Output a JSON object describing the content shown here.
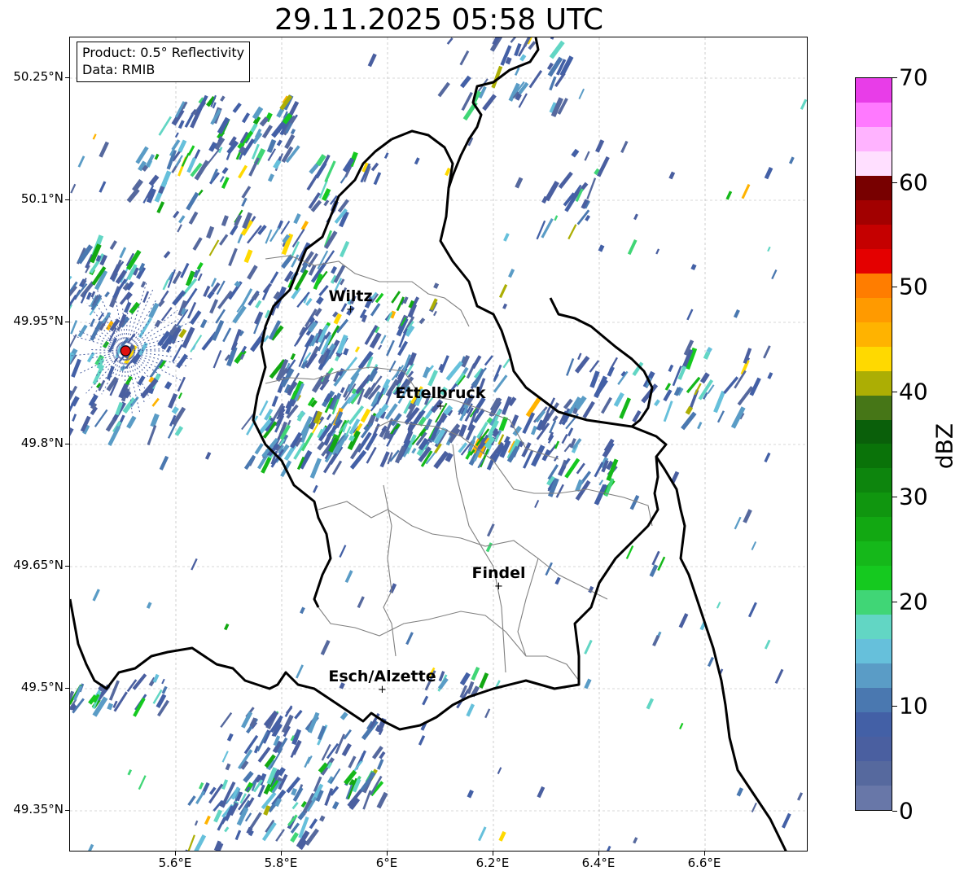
{
  "title": "29.11.2025 05:58 UTC",
  "info": {
    "product": "Product: 0.5° Reflectivity",
    "data_source": "Data: RMIB"
  },
  "lat_ticks": [
    "50.25°N",
    "50.1°N",
    "49.95°N",
    "49.8°N",
    "49.65°N",
    "49.5°N",
    "49.35°N"
  ],
  "lon_ticks": [
    "5.6°E",
    "5.8°E",
    "6°E",
    "6.2°E",
    "6.4°E",
    "6.6°E"
  ],
  "cities": [
    {
      "name": "Wiltz",
      "lon": 5.93,
      "lat": 49.967
    },
    {
      "name": "Ettelbruck",
      "lon": 6.1,
      "lat": 49.848
    },
    {
      "name": "Findel",
      "lon": 6.21,
      "lat": 49.627
    },
    {
      "name": "Esch/Alzette",
      "lon": 5.99,
      "lat": 49.5
    }
  ],
  "radar_site": {
    "lon": 5.505,
    "lat": 49.915,
    "color": "#e01010"
  },
  "colorbar": {
    "label": "dBZ",
    "ticks": [
      "0",
      "10",
      "20",
      "30",
      "40",
      "50",
      "60",
      "70"
    ],
    "min": 0,
    "max": 70,
    "step": 2.5,
    "colors": [
      "#6877a8",
      "#56699e",
      "#4a5fa0",
      "#4360a6",
      "#4a78b0",
      "#5a9cc6",
      "#66c0db",
      "#62d6c4",
      "#40d676",
      "#15c91f",
      "#15b81a",
      "#12a812",
      "#10960f",
      "#0d850d",
      "#0a7309",
      "#0a5f0a",
      "#467617",
      "#acae04",
      "#ffd900",
      "#ffb300",
      "#ff9a00",
      "#ff7d00",
      "#e40000",
      "#c50000",
      "#a20000",
      "#780000",
      "#ffdfff",
      "#ffb3ff",
      "#ff79ff",
      "#e83de8"
    ]
  },
  "map_colors": {
    "border": "#000000",
    "canton_lines": "#808080",
    "grid": "#b0b0b0"
  }
}
